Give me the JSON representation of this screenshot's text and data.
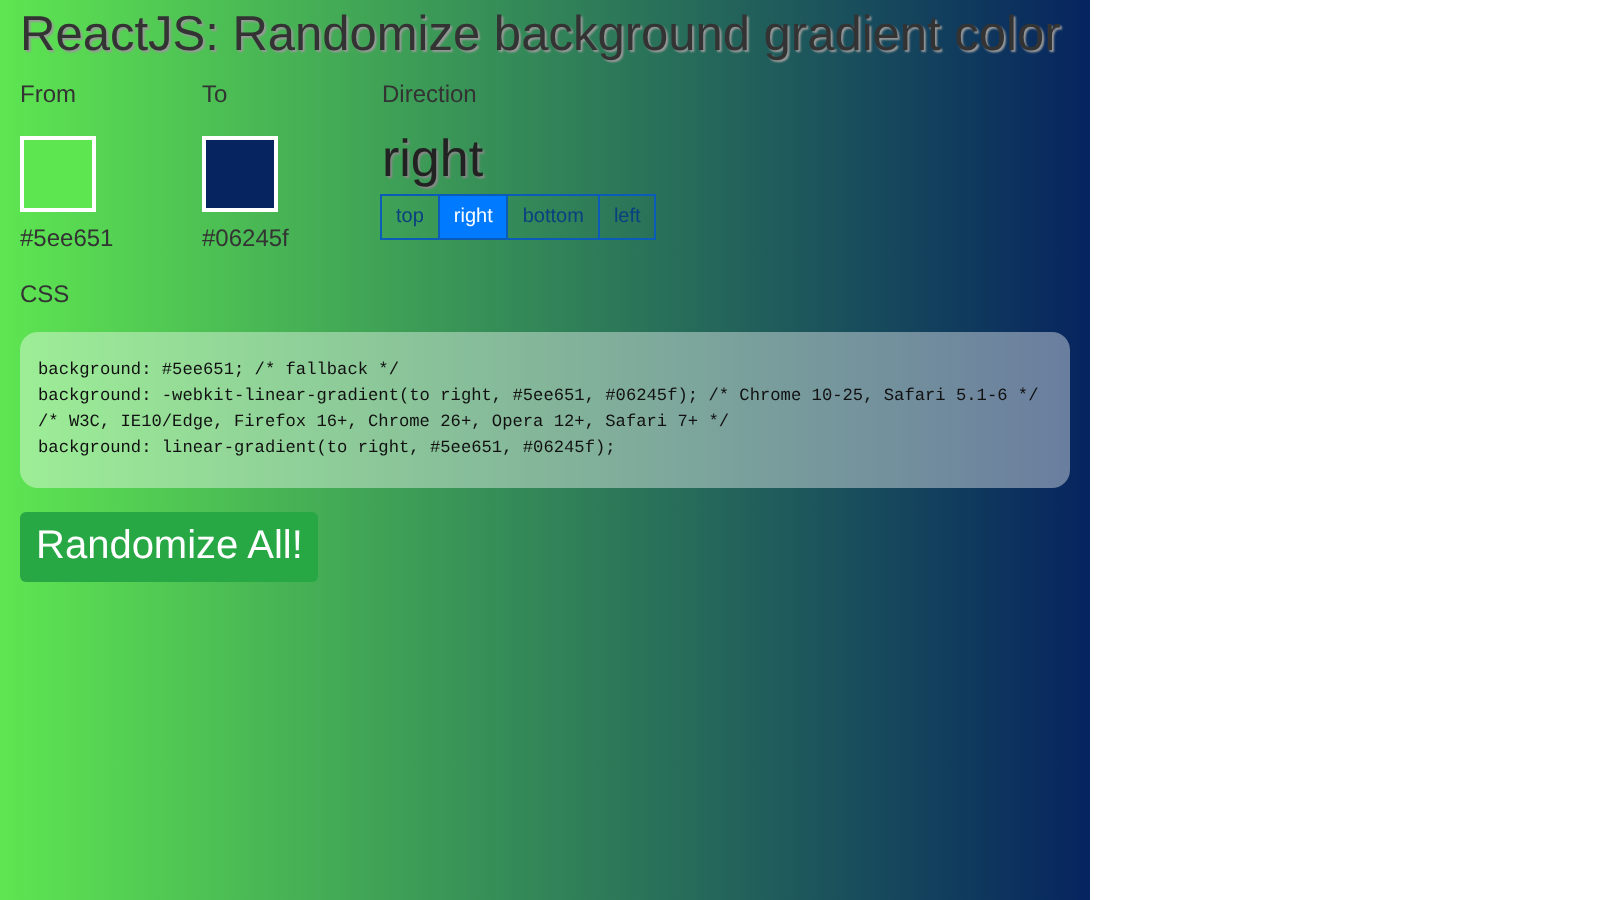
{
  "title": "ReactJS: Randomize background gradient color",
  "from": {
    "label": "From",
    "color": "#5ee651",
    "value": "#5ee651"
  },
  "to": {
    "label": "To",
    "color": "#06245f",
    "value": "#06245f"
  },
  "direction": {
    "label": "Direction",
    "value": "right",
    "options": [
      {
        "label": "top",
        "selected": false
      },
      {
        "label": "right",
        "selected": true
      },
      {
        "label": "bottom",
        "selected": false
      },
      {
        "label": "left",
        "selected": false
      }
    ]
  },
  "css": {
    "label": "CSS",
    "lines": [
      "background: #5ee651; /* fallback */",
      "background: -webkit-linear-gradient(to right, #5ee651, #06245f); /* Chrome 10-25, Safari 5.1-6 */",
      "/* W3C, IE10/Edge, Firefox 16+, Chrome 26+, Opera 12+, Safari 7+ */",
      "background: linear-gradient(to right, #5ee651, #06245f);"
    ]
  },
  "button": {
    "label": "Randomize All!"
  }
}
